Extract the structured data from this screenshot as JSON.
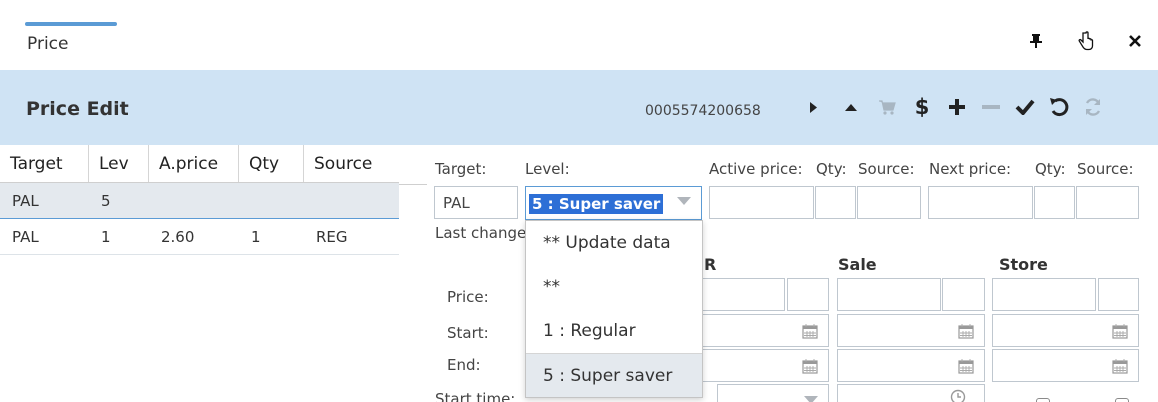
{
  "tab": {
    "title": "Price"
  },
  "window_icons": [
    "pin-icon",
    "pointer-hand-icon",
    "close-icon"
  ],
  "header": {
    "title": "Price Edit",
    "barcode": "0005574200658",
    "toolbar": [
      "play-next-icon",
      "collapse-up-icon",
      "cart-icon",
      "dollar-icon",
      "plus-icon",
      "minus-icon",
      "check-icon",
      "undo-icon",
      "refresh-icon"
    ],
    "toolbar_labels": {
      "dollar": "$"
    }
  },
  "grid": {
    "columns": [
      "Target",
      "Lev",
      "A.price",
      "Qty",
      "Source"
    ],
    "rows": [
      {
        "target": "PAL",
        "lev": "5",
        "aprice": "",
        "qty": "",
        "source": ""
      },
      {
        "target": "PAL",
        "lev": "1",
        "aprice": "2.60",
        "qty": "1",
        "source": "REG"
      }
    ]
  },
  "form": {
    "labels": {
      "target": "Target:",
      "level": "Level:",
      "active_price": "Active price:",
      "qty1": "Qty:",
      "source1": "Source:",
      "next_price": "Next price:",
      "qty2": "Qty:",
      "source2": "Source:",
      "last_change": "Last change",
      "price": "Price:",
      "start": "Start:",
      "end": "End:",
      "start_time": "Start time:"
    },
    "target_value": "PAL",
    "level_value": "5 : Super saver",
    "sections": {
      "reg": "R",
      "sale": "Sale",
      "store": "Store"
    }
  },
  "dropdown": {
    "items": [
      "** Update data",
      "**",
      "1 : Regular",
      "5 : Super saver"
    ],
    "selected_index": 3
  },
  "colors": {
    "header_bg": "#cfe3f4",
    "accent": "#5b9bd5",
    "selection": "#2d6fd6"
  }
}
